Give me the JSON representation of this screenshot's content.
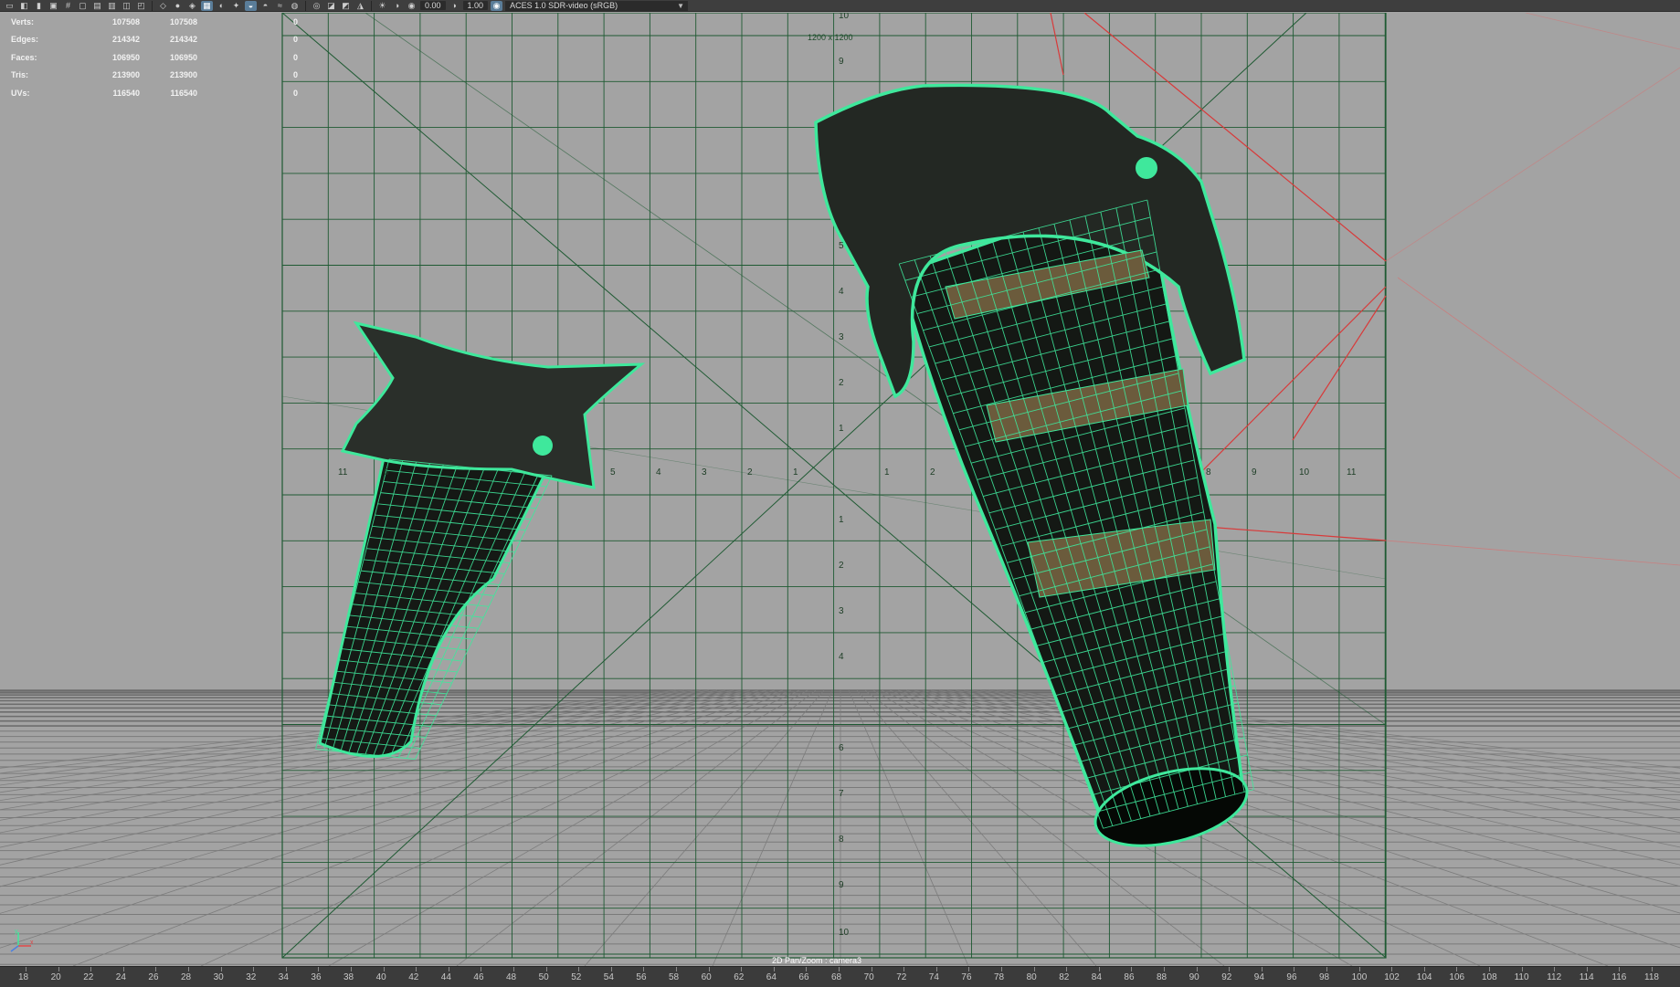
{
  "toolbar": {
    "icons": [
      "camera-select-icon",
      "camera-attributes-icon",
      "bookmark-icon",
      "image-plane-icon",
      "grid-icon",
      "film-gate-icon",
      "resolution-gate-icon",
      "field-chart-icon",
      "safe-action-icon",
      "safe-title-icon",
      "wireframe-icon",
      "smooth-shade-icon",
      "shaded-wireframe-icon",
      "bounding-box-icon",
      "textured-icon",
      "lights-icon",
      "shadows-icon",
      "ambient-occlusion-icon",
      "motion-blur-icon",
      "antialiasing-icon",
      "isolate-select-icon",
      "xray-icon",
      "xray-joints-icon",
      "backface-icon",
      "exposure-icon",
      "gamma-icon",
      "color-management-icon"
    ],
    "exposure_value": "0.00",
    "gamma_value": "1.00",
    "color_space": "ACES 1.0 SDR-video (sRGB)"
  },
  "hud": {
    "rows": [
      {
        "label": "Verts:",
        "value1": "107508",
        "value2": "107508",
        "value3": "0"
      },
      {
        "label": "Edges:",
        "value1": "214342",
        "value2": "214342",
        "value3": "0"
      },
      {
        "label": "Faces:",
        "value1": "106950",
        "value2": "106950",
        "value3": "0"
      },
      {
        "label": "Tris:",
        "value1": "213900",
        "value2": "213900",
        "value3": "0"
      },
      {
        "label": "UVs:",
        "value1": "116540",
        "value2": "116540",
        "value3": "0"
      }
    ]
  },
  "viewport": {
    "resolution_label": "1200 x 1200",
    "camera_label": "2D Pan/Zoom : camera3",
    "grid_left_labels": [
      "11",
      "6",
      "5",
      "4",
      "3",
      "2",
      "1"
    ],
    "grid_right_labels": [
      "1",
      "2",
      "8",
      "9",
      "10",
      "11"
    ],
    "grid_top_labels": [
      "10",
      "9",
      "5",
      "4",
      "3",
      "2",
      "1"
    ],
    "grid_bottom_labels": [
      "1",
      "2",
      "3",
      "4",
      "6",
      "7",
      "8",
      "9",
      "10"
    ]
  },
  "timeline": {
    "ticks": [
      "18",
      "20",
      "22",
      "24",
      "26",
      "28",
      "30",
      "32",
      "34",
      "36",
      "38",
      "40",
      "42",
      "44",
      "46",
      "48",
      "50",
      "52",
      "54",
      "56",
      "58",
      "60",
      "62",
      "64",
      "66",
      "68",
      "70",
      "72",
      "74",
      "76",
      "78",
      "80",
      "82",
      "84",
      "86",
      "88",
      "90",
      "92",
      "94",
      "96",
      "98",
      "100",
      "102",
      "104",
      "106",
      "108",
      "110",
      "112",
      "114",
      "116",
      "118"
    ]
  },
  "colors": {
    "viewport_background": "#a3a3a3",
    "selection_wireframe": "#3fe89c",
    "grid_lines": "#1f5a33",
    "toolbar": "#3e3e3e",
    "timeline": "#3b3b3b"
  }
}
